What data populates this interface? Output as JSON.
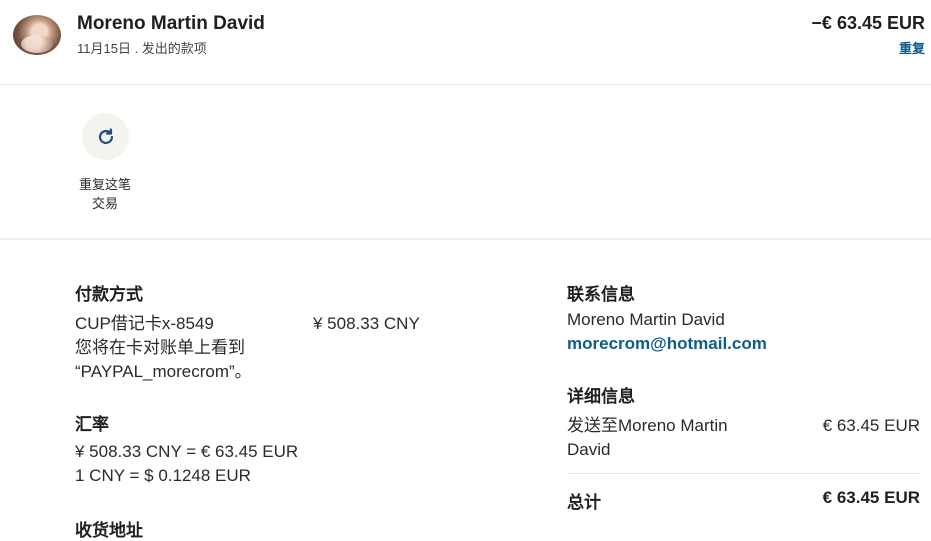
{
  "header": {
    "name": "Moreno Martin David",
    "subtitle": "11月15日 . 发出的款项",
    "amount": "−€ 63.45 EUR",
    "repeat_link": "重复"
  },
  "actions": {
    "repeat_label_line1": "重复这笔",
    "repeat_label_line2": "交易",
    "icon": "refresh-icon"
  },
  "payment": {
    "title": "付款方式",
    "card": "CUP借记卡x-8549",
    "amount": "¥ 508.33 CNY",
    "note_line1": "您将在卡对账单上看到",
    "note_line2": "“PAYPAL_morecrom”。"
  },
  "exchange": {
    "title": "汇率",
    "line1": "¥ 508.33 CNY = € 63.45 EUR",
    "line2": "1 CNY = $ 0.1248 EUR"
  },
  "shipping": {
    "title": "收货地址"
  },
  "contact": {
    "title": "联系信息",
    "name": "Moreno Martin David",
    "email": "morecrom@hotmail.com"
  },
  "details": {
    "title": "详细信息",
    "sent_to_line1": "发送至Moreno Martin",
    "sent_to_line2": "David",
    "sent_amount": "€ 63.45 EUR",
    "total_label": "总计",
    "total_amount": "€ 63.45 EUR"
  },
  "colors": {
    "link": "#0d5c8b",
    "text": "#1f1f1f",
    "divider": "#e6e6e6"
  }
}
